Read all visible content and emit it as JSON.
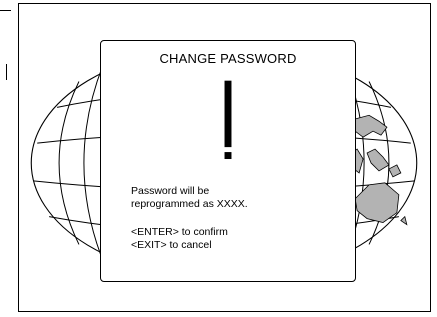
{
  "dialog": {
    "title": "CHANGE PASSWORD",
    "message_line1": "Password will be",
    "message_line2": "reprogrammed as XXXX.",
    "confirm_hint": "<ENTER> to confirm",
    "cancel_hint": "<EXIT> to cancel"
  },
  "icons": {
    "warning": "exclamation-icon",
    "background": "world-globe-graphic"
  },
  "colors": {
    "line": "#000000",
    "land": "#b3b3b3",
    "background": "#ffffff"
  }
}
